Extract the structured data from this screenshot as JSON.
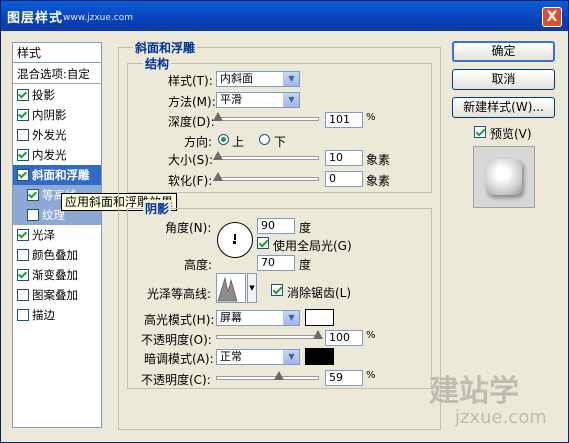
{
  "window": {
    "title": "图层样式",
    "watermark_url": "www.jzxue.com",
    "close_glyph": "X"
  },
  "style_list": {
    "header": "样式",
    "blending": "混合选项:自定",
    "items": [
      {
        "label": "投影",
        "checked": true
      },
      {
        "label": "内阴影",
        "checked": true
      },
      {
        "label": "外发光",
        "checked": false
      },
      {
        "label": "内发光",
        "checked": true
      },
      {
        "label": "斜面和浮雕",
        "checked": true
      },
      {
        "label": "等高线",
        "checked": true
      },
      {
        "label": "纹理",
        "checked": false
      },
      {
        "label": "光泽",
        "checked": true
      },
      {
        "label": "颜色叠加",
        "checked": false
      },
      {
        "label": "渐变叠加",
        "checked": true
      },
      {
        "label": "图案叠加",
        "checked": false
      },
      {
        "label": "描边",
        "checked": false
      }
    ]
  },
  "tooltip": "应用斜面和浮雕效果",
  "bevel": {
    "group_title": "斜面和浮雕",
    "structure_title": "结构",
    "style_label": "样式(T):",
    "style_value": "内斜面",
    "technique_label": "方法(M):",
    "technique_value": "平滑",
    "depth_label": "深度(D):",
    "depth_value": "101",
    "depth_unit": "%",
    "direction_label": "方向:",
    "direction_up": "上",
    "direction_down": "下",
    "size_label": "大小(S):",
    "size_value": "10",
    "size_unit": "象素",
    "soften_label": "软化(F):",
    "soften_value": "0",
    "soften_unit": "象素"
  },
  "shading": {
    "title": "阴影",
    "angle_label": "角度(N):",
    "angle_value": "90",
    "angle_unit": "度",
    "global_light_label": "使用全局光(G)",
    "altitude_label": "高度:",
    "altitude_value": "70",
    "altitude_unit": "度",
    "gloss_label": "光泽等高线:",
    "antialias_label": "消除锯齿(L)",
    "highlight_mode_label": "高光模式(H):",
    "highlight_mode_value": "屏幕",
    "highlight_color": "#ffffff",
    "highlight_opacity_label": "不透明度(O):",
    "highlight_opacity_value": "100",
    "opacity_unit": "%",
    "shadow_mode_label": "暗调模式(A):",
    "shadow_mode_value": "正常",
    "shadow_color": "#000000",
    "shadow_opacity_label": "不透明度(C):",
    "shadow_opacity_value": "59"
  },
  "buttons": {
    "ok": "确定",
    "cancel": "取消",
    "new_style": "新建样式(W)...",
    "preview": "预览(V)"
  },
  "watermark": {
    "logo": "建站学",
    "url": "jzxue.com"
  }
}
